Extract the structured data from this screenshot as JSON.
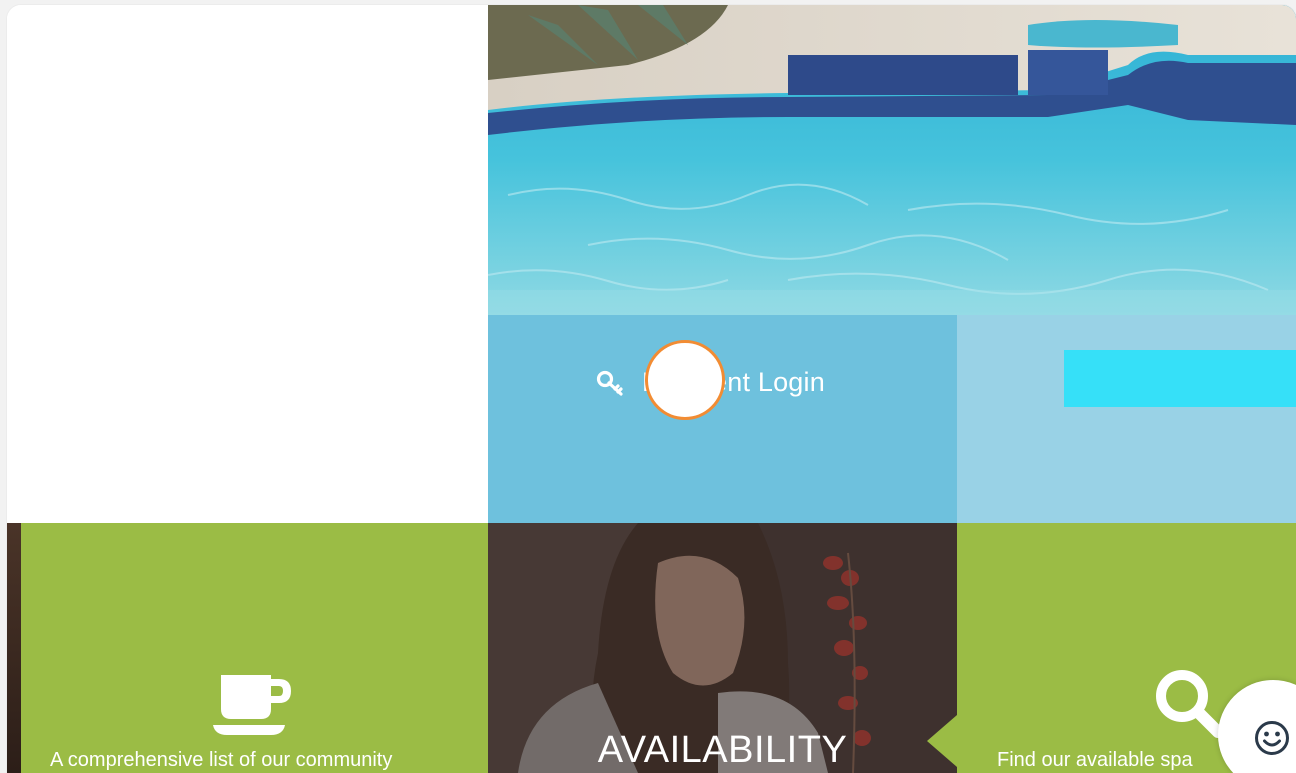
{
  "login_tile": {
    "label": "Resident Login",
    "visible_fragment_left": "R",
    "visible_fragment_right": "nt Login",
    "icon": "key-icon"
  },
  "availability_tile": {
    "label": "AVAILABILITY"
  },
  "amenities_tile": {
    "text": "A comprehensive list of our community",
    "icon": "coffee-cup-icon"
  },
  "search_tile": {
    "text": "Find our available spa",
    "icon": "search-icon"
  },
  "feedback": {
    "icon": "smiley-icon"
  },
  "colors": {
    "login_blue": "#6ec1dd",
    "light_blue": "#99d2e6",
    "cyan_bar": "#36e0f8",
    "green": "#9bbc45",
    "click_marker_border": "#f28c33"
  }
}
